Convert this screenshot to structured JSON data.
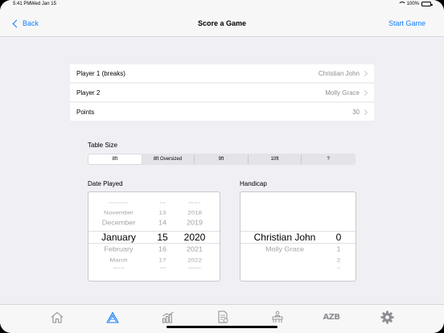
{
  "status": {
    "time": "5:41 PM",
    "date": "Wed Jan 15",
    "battery": "100%"
  },
  "nav": {
    "back_label": "Back",
    "title": "Score a Game",
    "action_label": "Start Game"
  },
  "rows": [
    {
      "label": "Player 1 (breaks)",
      "value": "Christian John"
    },
    {
      "label": "Player 2",
      "value": "Molly Grace"
    },
    {
      "label": "Points",
      "value": "30"
    }
  ],
  "table_size": {
    "label": "Table Size",
    "options": [
      "8ft",
      "8ft Oversized",
      "9ft",
      "10ft",
      "?"
    ],
    "selected": "8ft"
  },
  "date_played": {
    "label": "Date Played",
    "months": [
      "October",
      "November",
      "December",
      "January",
      "February",
      "March",
      "April"
    ],
    "days": [
      "12",
      "13",
      "14",
      "15",
      "16",
      "17",
      "18"
    ],
    "years": [
      "2017",
      "2018",
      "2019",
      "2020",
      "2021",
      "2022",
      "2023"
    ],
    "selected": {
      "month": "January",
      "day": "15",
      "year": "2020"
    }
  },
  "handicap": {
    "label": "Handicap",
    "players": [
      "Christian John",
      "Molly Grace"
    ],
    "values": [
      "0",
      "1",
      "2",
      "3"
    ],
    "selected": {
      "player": "Christian John",
      "value": "0"
    }
  },
  "tabbar": {
    "items": [
      "home-icon",
      "rack-icon",
      "stats-icon",
      "scoresheet-icon",
      "pool-table-icon",
      "azb-icon",
      "gear-icon"
    ],
    "azb_text": "AZB",
    "active": "rack-icon",
    "active_color": "#147efb",
    "inactive_color": "#8e8e93"
  }
}
